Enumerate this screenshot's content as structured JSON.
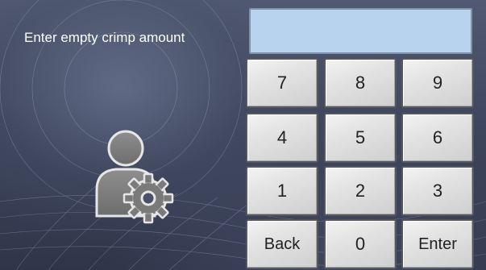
{
  "prompt": {
    "label": "Enter empty crimp amount"
  },
  "input": {
    "value": ""
  },
  "keypad": {
    "keys": [
      "7",
      "8",
      "9",
      "4",
      "5",
      "6",
      "1",
      "2",
      "3",
      "Back",
      "0",
      "Enter"
    ]
  },
  "icons": {
    "user_settings": "user-settings-icon"
  },
  "colors": {
    "display_bg": "#b7d3ee",
    "key_bg": "#e4e4e4",
    "text": "#ffffff"
  }
}
